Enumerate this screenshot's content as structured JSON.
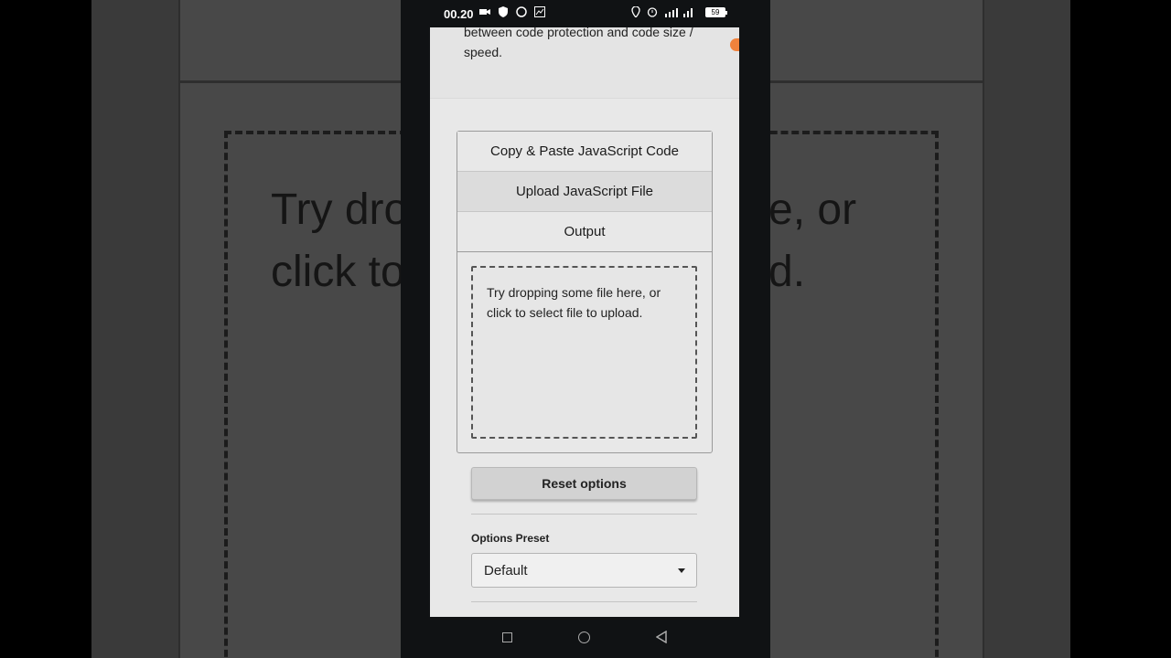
{
  "status_bar": {
    "time": "00.20",
    "battery": "59"
  },
  "page": {
    "intro_text": "between code protection and code size / speed."
  },
  "tabs": [
    {
      "label": "Copy & Paste JavaScript Code"
    },
    {
      "label": "Upload JavaScript File",
      "active": true
    },
    {
      "label": "Output"
    }
  ],
  "dropzone": {
    "text": "Try dropping some file here, or click to select file to upload."
  },
  "reset_button": {
    "label": "Reset options"
  },
  "options_preset": {
    "label": "Options Preset",
    "selected": "Default"
  },
  "background_text": {
    "left": "Try dro\nclick to",
    "right": "e, or\nd."
  },
  "colors": {
    "accent": "#f0823c",
    "screen_bg": "#e8e8e8",
    "phone_frame": "#101214"
  },
  "icons": [
    "camera-icon",
    "shield-icon",
    "whatsapp-icon",
    "chart-icon",
    "location-icon",
    "alarm-icon",
    "signal-icon",
    "battery-icon",
    "square-nav-icon",
    "home-nav-icon",
    "back-nav-icon"
  ]
}
